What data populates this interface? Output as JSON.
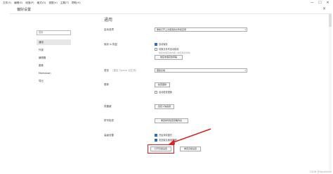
{
  "menubar": {
    "items": [
      "文件(F)",
      "编辑(E)",
      "段落(P)",
      "格式(O)",
      "视图(V)",
      "主题(T)",
      "帮助(H)"
    ],
    "controls": [
      "—",
      "☐",
      "✕"
    ]
  },
  "prefs": {
    "title": "偏好设置",
    "close": "✕"
  },
  "sidebar": {
    "search_placeholder": "搜索",
    "items": [
      "通用",
      "外观",
      "编辑器",
      "图像",
      "Markdown",
      "导出"
    ],
    "active_index": 0
  },
  "main": {
    "section_title": "通用",
    "startup": {
      "label": "启动选项",
      "value": "重新打开上次使用的文件和目录"
    },
    "save_restore": {
      "label": "保存 & 恢复",
      "auto_save": "自动保存",
      "auto_save_checked": true,
      "save_on_switch": "切换文件时自动保存",
      "save_on_switch_checked": false,
      "save_on_switch_note": "恢复未保存的内容 (未找到文件时)",
      "recover_button": "恢复未保存的草稿"
    },
    "language": {
      "label": "语言",
      "note": "(重启 Typora 后生效)",
      "value": "跟随系统"
    },
    "update": {
      "label": "更新",
      "check_button": "检查更新",
      "auto_check": "自动检查更新",
      "auto_check_checked": false
    },
    "shortcuts": {
      "label": "快捷键",
      "button": "自定义快捷键"
    },
    "spellcheck": {
      "label": "拼写检查",
      "button": "重置拼写检查忽略列表"
    },
    "advanced": {
      "label": "高级设置",
      "debug_mode": "开启调试模式",
      "debug_mode_checked": true,
      "telemetry": "发送匿名使用数据",
      "telemetry_checked": true,
      "open_advanced_button": "打开高级设置",
      "reset_advanced_button": "重置高级设置"
    }
  },
  "watermark": "CSDN @AquaWork",
  "accent": "#2d6ec9",
  "annotation_color": "#e02020"
}
